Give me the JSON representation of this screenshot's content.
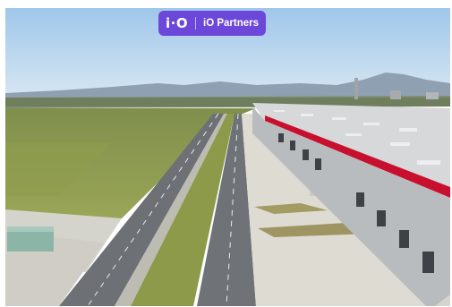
{
  "badge": {
    "logo_text": "i·O",
    "label": "iO Partners"
  },
  "photo": {
    "subject": "aerial-logistics-warehouse",
    "colors": {
      "sky": "#b9d6f0",
      "roof": "#d8dadb",
      "red_stripe": "#c8102e",
      "grass": "#8a9a4a",
      "road": "#6f7377",
      "pavement": "#d9d6cf",
      "badge_bg": "#6c47d9"
    }
  }
}
